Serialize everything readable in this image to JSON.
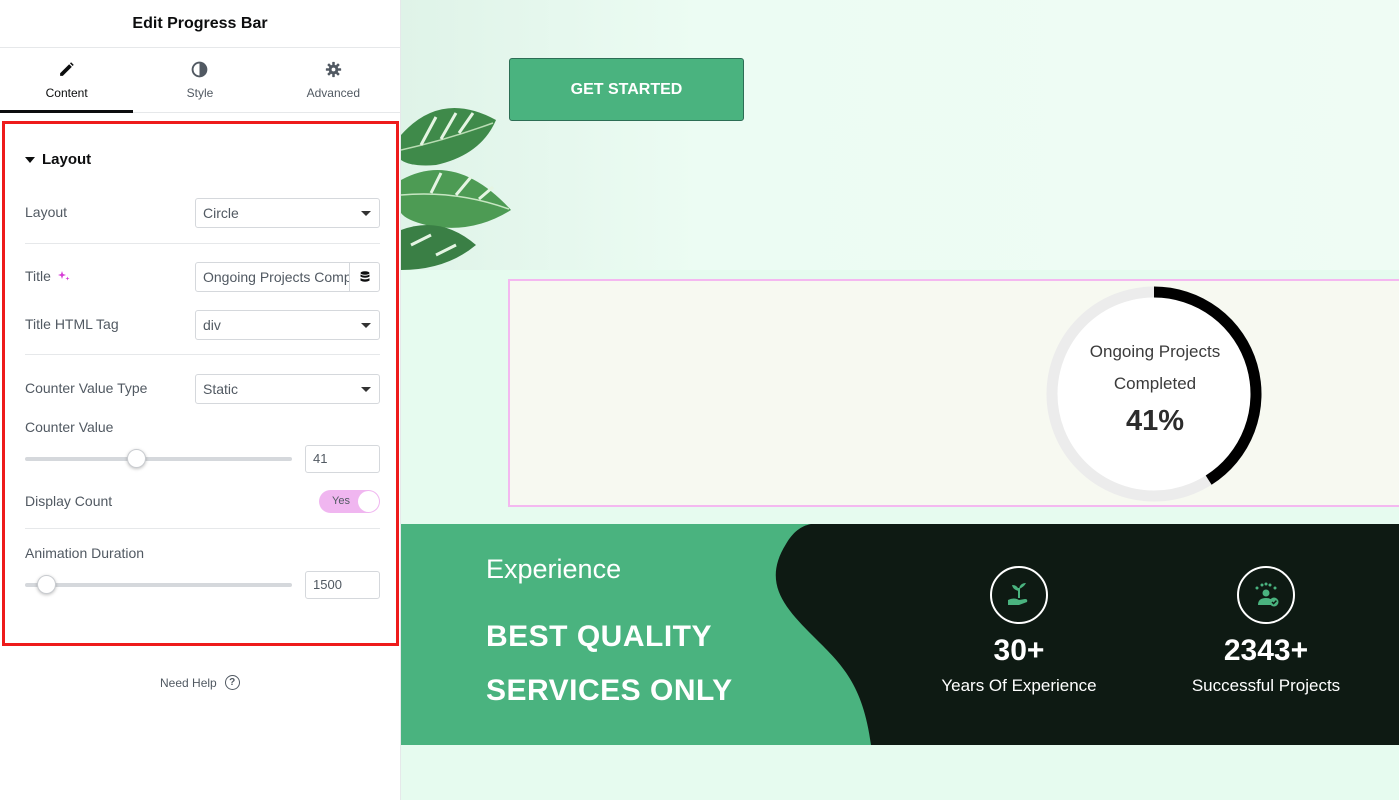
{
  "panel": {
    "title": "Edit Progress Bar",
    "tabs": [
      {
        "label": "Content",
        "icon": "pencil-icon",
        "active": true
      },
      {
        "label": "Style",
        "icon": "half-circle-icon",
        "active": false
      },
      {
        "label": "Advanced",
        "icon": "gear-icon",
        "active": false
      }
    ],
    "section_title": "Layout",
    "fields": {
      "layout": {
        "label": "Layout",
        "value": "Circle"
      },
      "title": {
        "label": "Title",
        "value": "Ongoing Projects Completed"
      },
      "title_tag": {
        "label": "Title HTML Tag",
        "value": "div"
      },
      "counter_type": {
        "label": "Counter Value Type",
        "value": "Static"
      },
      "counter_value": {
        "label": "Counter Value",
        "value": "41",
        "slider_fraction": 0.41
      },
      "display_count": {
        "label": "Display Count",
        "value": "Yes"
      },
      "animation": {
        "label": "Animation Duration",
        "value": "1500",
        "slider_fraction": 0.05
      }
    },
    "help": "Need Help",
    "accent_color": "#ee1b1b"
  },
  "preview": {
    "cta": "GET STARTED",
    "progress": {
      "title_line1": "Ongoing Projects",
      "title_line2": "Completed",
      "value_text": "41%",
      "percent": 41
    },
    "stats": {
      "label": "Experience",
      "headline_line1": "BEST QUALITY",
      "headline_line2": "SERVICES ONLY",
      "items": [
        {
          "number": "30+",
          "label": "Years Of Experience",
          "icon": "plant-hand-icon"
        },
        {
          "number": "2343+",
          "label": "Successful Projects",
          "icon": "user-rating-icon"
        }
      ]
    },
    "colors": {
      "green": "#4ab37f",
      "dark": "#0e1a13",
      "mint": "#e6fbef"
    }
  }
}
